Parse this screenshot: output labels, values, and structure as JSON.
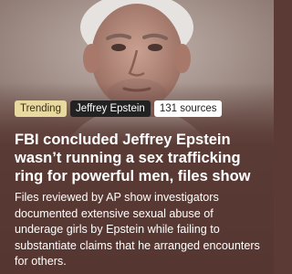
{
  "story": {
    "tags": {
      "trending": "Trending",
      "topic": "Jeffrey Epstein",
      "sources": "131 sources"
    },
    "headline": "FBI concluded Jeffrey Epstein wasn’t running a sex trafficking ring for powerful men, files show",
    "summary": "Files reviewed by AP show investigators documented extensive sexual abuse of underage girls by Epstein while failing to substantiate claims that he arranged encounters for others.",
    "colors": {
      "background": "#5a3a34",
      "trending_tag": "#e7d9a0",
      "topic_tag": "#222222",
      "sources_tag": "#ffffff"
    }
  }
}
